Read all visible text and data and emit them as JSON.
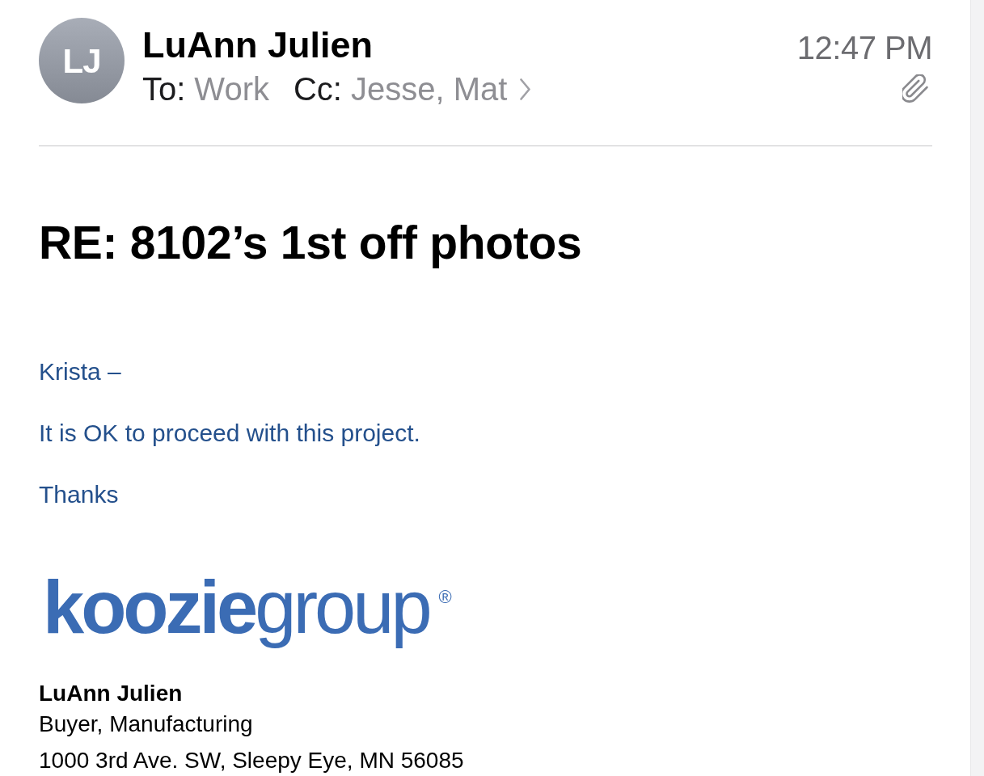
{
  "header": {
    "avatar_initials": "LJ",
    "sender": "LuAnn Julien",
    "to_label": "To:",
    "to": "Work",
    "cc_label": "Cc:",
    "cc": "Jesse, Mat",
    "time": "12:47 PM",
    "has_attachment": true
  },
  "subject": "RE: 8102’s 1st off photos",
  "body": {
    "paragraphs": [
      "Krista –",
      "It is OK to proceed with this project.",
      "Thanks"
    ]
  },
  "signature": {
    "logo": "**koozie**group$^{®}$",
    "name": "LuAnn Julien",
    "title": "Buyer, Manufacturing",
    "address": "1000 3rd Ave. SW, Sleepy Eye, MN 56085"
  }
}
